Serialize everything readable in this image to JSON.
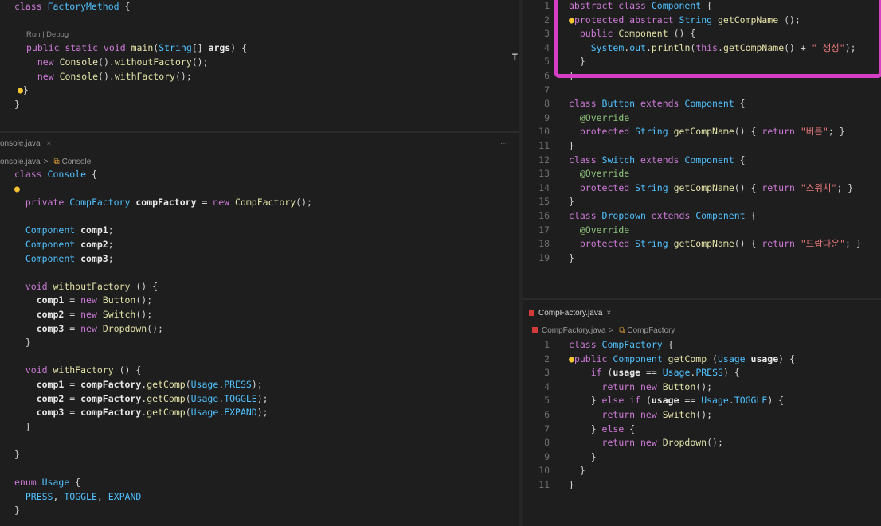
{
  "top_left": {
    "codelens": "Run | Debug",
    "lines": [
      [
        [
          "kw",
          "class "
        ],
        [
          "cls",
          "FactoryMethod "
        ],
        [
          "",
          "{"
        ]
      ],
      [],
      [],
      [
        [
          "kw",
          "public static void "
        ],
        [
          "fn",
          "main"
        ],
        [
          "",
          "("
        ],
        [
          "ty",
          "String"
        ],
        [
          "",
          "[] "
        ],
        [
          "id",
          "args"
        ],
        [
          "",
          ") {"
        ]
      ],
      [
        [
          "",
          "  "
        ],
        [
          "kw",
          "new "
        ],
        [
          "fn",
          "Console"
        ],
        [
          "",
          "()."
        ],
        [
          "fn",
          "withoutFactory"
        ],
        [
          "",
          "();"
        ]
      ],
      [
        [
          "",
          "  "
        ],
        [
          "kw",
          "new "
        ],
        [
          "fn",
          "Console"
        ],
        [
          "",
          "()."
        ],
        [
          "fn",
          "withFactory"
        ],
        [
          "",
          "();"
        ]
      ],
      [
        [
          "bulb",
          "●"
        ],
        [
          "",
          "}"
        ]
      ],
      [
        [
          "",
          "}"
        ]
      ]
    ]
  },
  "left_editor": {
    "tab": "onsole.java",
    "tab_close": "×",
    "more": "···",
    "crumb_file": "onsole.java",
    "crumb_sep": ">",
    "crumb_symbol": "Console",
    "lines": [
      [
        [
          "kw",
          "class "
        ],
        [
          "cls",
          "Console "
        ],
        [
          "",
          "{"
        ]
      ],
      [
        [
          "bulb",
          "●"
        ]
      ],
      [
        [
          "",
          "  "
        ],
        [
          "kw",
          "private "
        ],
        [
          "ty",
          "CompFactory "
        ],
        [
          "id",
          "compFactory"
        ],
        [
          "",
          " = "
        ],
        [
          "kw",
          "new "
        ],
        [
          "fn",
          "CompFactory"
        ],
        [
          "",
          "();"
        ]
      ],
      [],
      [
        [
          "",
          "  "
        ],
        [
          "ty",
          "Component "
        ],
        [
          "id",
          "comp1"
        ],
        [
          "",
          ";"
        ]
      ],
      [
        [
          "",
          "  "
        ],
        [
          "ty",
          "Component "
        ],
        [
          "id",
          "comp2"
        ],
        [
          "",
          ";"
        ]
      ],
      [
        [
          "",
          "  "
        ],
        [
          "ty",
          "Component "
        ],
        [
          "id",
          "comp3"
        ],
        [
          "",
          ";"
        ]
      ],
      [],
      [
        [
          "",
          "  "
        ],
        [
          "kw",
          "void "
        ],
        [
          "fn",
          "withoutFactory "
        ],
        [
          "",
          "() {"
        ]
      ],
      [
        [
          "",
          "    "
        ],
        [
          "id",
          "comp1"
        ],
        [
          "",
          " = "
        ],
        [
          "kw",
          "new "
        ],
        [
          "fn",
          "Button"
        ],
        [
          "",
          "();"
        ]
      ],
      [
        [
          "",
          "    "
        ],
        [
          "id",
          "comp2"
        ],
        [
          "",
          " = "
        ],
        [
          "kw",
          "new "
        ],
        [
          "fn",
          "Switch"
        ],
        [
          "",
          "();"
        ]
      ],
      [
        [
          "",
          "    "
        ],
        [
          "id",
          "comp3"
        ],
        [
          "",
          " = "
        ],
        [
          "kw",
          "new "
        ],
        [
          "fn",
          "Dropdown"
        ],
        [
          "",
          "();"
        ]
      ],
      [
        [
          "",
          "  }"
        ]
      ],
      [],
      [
        [
          "",
          "  "
        ],
        [
          "kw",
          "void "
        ],
        [
          "fn",
          "withFactory "
        ],
        [
          "",
          "() {"
        ]
      ],
      [
        [
          "",
          "    "
        ],
        [
          "id",
          "comp1"
        ],
        [
          "",
          " = "
        ],
        [
          "id",
          "compFactory"
        ],
        [
          "",
          "."
        ],
        [
          "fn",
          "getComp"
        ],
        [
          "",
          "("
        ],
        [
          "ty",
          "Usage"
        ],
        [
          "",
          "."
        ],
        [
          "ty",
          "PRESS"
        ],
        [
          "",
          ");"
        ]
      ],
      [
        [
          "",
          "    "
        ],
        [
          "id",
          "comp2"
        ],
        [
          "",
          " = "
        ],
        [
          "id",
          "compFactory"
        ],
        [
          "",
          "."
        ],
        [
          "fn",
          "getComp"
        ],
        [
          "",
          "("
        ],
        [
          "ty",
          "Usage"
        ],
        [
          "",
          "."
        ],
        [
          "ty",
          "TOGGLE"
        ],
        [
          "",
          ");"
        ]
      ],
      [
        [
          "",
          "    "
        ],
        [
          "id",
          "comp3"
        ],
        [
          "",
          " = "
        ],
        [
          "id",
          "compFactory"
        ],
        [
          "",
          "."
        ],
        [
          "fn",
          "getComp"
        ],
        [
          "",
          "("
        ],
        [
          "ty",
          "Usage"
        ],
        [
          "",
          "."
        ],
        [
          "ty",
          "EXPAND"
        ],
        [
          "",
          ");"
        ]
      ],
      [
        [
          "",
          "  }"
        ]
      ],
      [],
      [
        [
          "",
          "}"
        ]
      ],
      [],
      [
        [
          "kw",
          "enum "
        ],
        [
          "cls",
          "Usage "
        ],
        [
          "",
          "{"
        ]
      ],
      [
        [
          "",
          "  "
        ],
        [
          "ty",
          "PRESS"
        ],
        [
          "",
          ", "
        ],
        [
          "ty",
          "TOGGLE"
        ],
        [
          "",
          ", "
        ],
        [
          "ty",
          "EXPAND"
        ]
      ],
      [
        [
          "",
          "}"
        ]
      ]
    ]
  },
  "right_top": {
    "lines": [
      {
        "n": "1",
        "t": [
          [
            "kw",
            "abstract class "
          ],
          [
            "cls",
            "Component "
          ],
          [
            "",
            "{"
          ]
        ]
      },
      {
        "n": "2",
        "t": [
          [
            "bulb",
            "●"
          ],
          [
            "kw",
            "protected abstract "
          ],
          [
            "ty",
            "String "
          ],
          [
            "fn",
            "getCompName "
          ],
          [
            "",
            "();"
          ]
        ]
      },
      {
        "n": "3",
        "t": [
          [
            "",
            "  "
          ],
          [
            "kw",
            "public "
          ],
          [
            "fn",
            "Component "
          ],
          [
            "",
            "() {"
          ]
        ]
      },
      {
        "n": "4",
        "t": [
          [
            "",
            "    "
          ],
          [
            "ty",
            "System"
          ],
          [
            "",
            "."
          ],
          [
            "ty",
            "out"
          ],
          [
            "",
            "."
          ],
          [
            "fn",
            "println"
          ],
          [
            "",
            "("
          ],
          [
            "kw",
            "this"
          ],
          [
            "",
            "."
          ],
          [
            "fn",
            "getCompName"
          ],
          [
            "",
            "() + "
          ],
          [
            "st",
            "\" 생성\""
          ],
          [
            "",
            ");"
          ]
        ]
      },
      {
        "n": "5",
        "t": [
          [
            "",
            "  }"
          ]
        ]
      },
      {
        "n": "6",
        "t": [
          [
            "",
            "}"
          ]
        ]
      },
      {
        "n": "7",
        "t": []
      },
      {
        "n": "8",
        "t": [
          [
            "kw",
            "class "
          ],
          [
            "cls",
            "Button "
          ],
          [
            "kw",
            "extends "
          ],
          [
            "cls",
            "Component "
          ],
          [
            "",
            "{"
          ]
        ]
      },
      {
        "n": "9",
        "t": [
          [
            "",
            "  "
          ],
          [
            "an",
            "@Override"
          ]
        ]
      },
      {
        "n": "10",
        "t": [
          [
            "",
            "  "
          ],
          [
            "kw",
            "protected "
          ],
          [
            "ty",
            "String "
          ],
          [
            "fn",
            "getCompName"
          ],
          [
            "",
            "() { "
          ],
          [
            "kw",
            "return "
          ],
          [
            "st",
            "\"버튼\""
          ],
          [
            "",
            "; }"
          ]
        ]
      },
      {
        "n": "11",
        "t": [
          [
            "",
            "}"
          ]
        ]
      },
      {
        "n": "12",
        "t": [
          [
            "kw",
            "class "
          ],
          [
            "cls",
            "Switch "
          ],
          [
            "kw",
            "extends "
          ],
          [
            "cls",
            "Component "
          ],
          [
            "",
            "{"
          ]
        ]
      },
      {
        "n": "13",
        "t": [
          [
            "",
            "  "
          ],
          [
            "an",
            "@Override"
          ]
        ]
      },
      {
        "n": "14",
        "t": [
          [
            "",
            "  "
          ],
          [
            "kw",
            "protected "
          ],
          [
            "ty",
            "String "
          ],
          [
            "fn",
            "getCompName"
          ],
          [
            "",
            "() { "
          ],
          [
            "kw",
            "return "
          ],
          [
            "st",
            "\"스위치\""
          ],
          [
            "",
            "; }"
          ]
        ]
      },
      {
        "n": "15",
        "t": [
          [
            "",
            "}"
          ]
        ]
      },
      {
        "n": "16",
        "t": [
          [
            "kw",
            "class "
          ],
          [
            "cls",
            "Dropdown "
          ],
          [
            "kw",
            "extends "
          ],
          [
            "cls",
            "Component "
          ],
          [
            "",
            "{"
          ]
        ]
      },
      {
        "n": "17",
        "t": [
          [
            "",
            "  "
          ],
          [
            "an",
            "@Override"
          ]
        ]
      },
      {
        "n": "18",
        "t": [
          [
            "",
            "  "
          ],
          [
            "kw",
            "protected "
          ],
          [
            "ty",
            "String "
          ],
          [
            "fn",
            "getCompName"
          ],
          [
            "",
            "() { "
          ],
          [
            "kw",
            "return "
          ],
          [
            "st",
            "\"드랍다운\""
          ],
          [
            "",
            "; }"
          ]
        ]
      },
      {
        "n": "19",
        "t": [
          [
            "",
            "}"
          ]
        ]
      }
    ]
  },
  "right_bottom": {
    "tab": "CompFactory.java",
    "tab_close": "×",
    "crumb_file": "CompFactory.java",
    "crumb_sep": ">",
    "crumb_symbol": "CompFactory",
    "lines": [
      {
        "n": "1",
        "t": [
          [
            "kw",
            "class "
          ],
          [
            "cls",
            "CompFactory "
          ],
          [
            "",
            "{"
          ]
        ]
      },
      {
        "n": "2",
        "t": [
          [
            "bulb",
            "●"
          ],
          [
            "kw",
            "public "
          ],
          [
            "ty",
            "Component "
          ],
          [
            "fn",
            "getComp "
          ],
          [
            "",
            "("
          ],
          [
            "ty",
            "Usage "
          ],
          [
            "id",
            "usage"
          ],
          [
            "",
            ") {"
          ]
        ]
      },
      {
        "n": "3",
        "t": [
          [
            "",
            "    "
          ],
          [
            "kw",
            "if "
          ],
          [
            "",
            "("
          ],
          [
            "id",
            "usage"
          ],
          [
            "",
            " == "
          ],
          [
            "ty",
            "Usage"
          ],
          [
            "",
            "."
          ],
          [
            "ty",
            "PRESS"
          ],
          [
            "",
            ") {"
          ]
        ]
      },
      {
        "n": "4",
        "t": [
          [
            "",
            "      "
          ],
          [
            "kw",
            "return new "
          ],
          [
            "fn",
            "Button"
          ],
          [
            "",
            "();"
          ]
        ]
      },
      {
        "n": "5",
        "t": [
          [
            "",
            "    } "
          ],
          [
            "kw",
            "else if "
          ],
          [
            "",
            "("
          ],
          [
            "id",
            "usage"
          ],
          [
            "",
            " == "
          ],
          [
            "ty",
            "Usage"
          ],
          [
            "",
            "."
          ],
          [
            "ty",
            "TOGGLE"
          ],
          [
            "",
            ") {"
          ]
        ]
      },
      {
        "n": "6",
        "t": [
          [
            "",
            "      "
          ],
          [
            "kw",
            "return new "
          ],
          [
            "fn",
            "Switch"
          ],
          [
            "",
            "();"
          ]
        ]
      },
      {
        "n": "7",
        "t": [
          [
            "",
            "    } "
          ],
          [
            "kw",
            "else "
          ],
          [
            "",
            "{"
          ]
        ]
      },
      {
        "n": "8",
        "t": [
          [
            "",
            "      "
          ],
          [
            "kw",
            "return new "
          ],
          [
            "fn",
            "Dropdown"
          ],
          [
            "",
            "();"
          ]
        ]
      },
      {
        "n": "9",
        "t": [
          [
            "",
            "    }"
          ]
        ]
      },
      {
        "n": "10",
        "t": [
          [
            "",
            "  }"
          ]
        ]
      },
      {
        "n": "11",
        "t": [
          [
            "",
            "}"
          ]
        ]
      }
    ]
  },
  "cursor_glyph": "T"
}
